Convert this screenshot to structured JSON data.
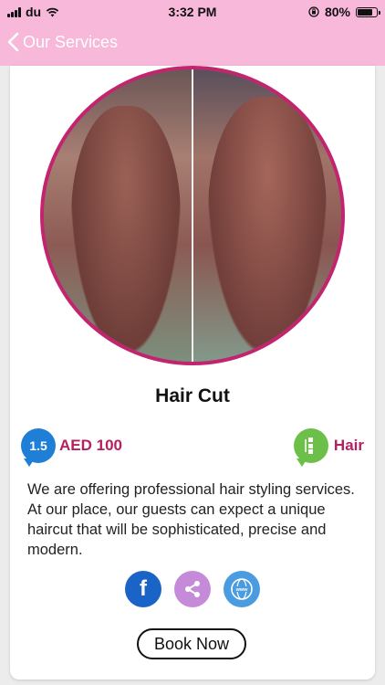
{
  "status_bar": {
    "carrier": "du",
    "time": "3:32 PM",
    "battery": "80%"
  },
  "nav": {
    "title": "Our Services"
  },
  "service": {
    "title": "Hair Cut",
    "price": "AED 100",
    "category": "Hair",
    "description": "We are offering professional hair styling services. At our place, our guests can expect a unique haircut that will be sophisticated, precise and modern."
  },
  "share_icons": [
    "facebook-icon",
    "share-icon",
    "www-icon"
  ],
  "book_button": "Book Now",
  "colors": {
    "header": "#f7b8d9",
    "accent": "#b5205f",
    "ring": "#c2246f"
  }
}
